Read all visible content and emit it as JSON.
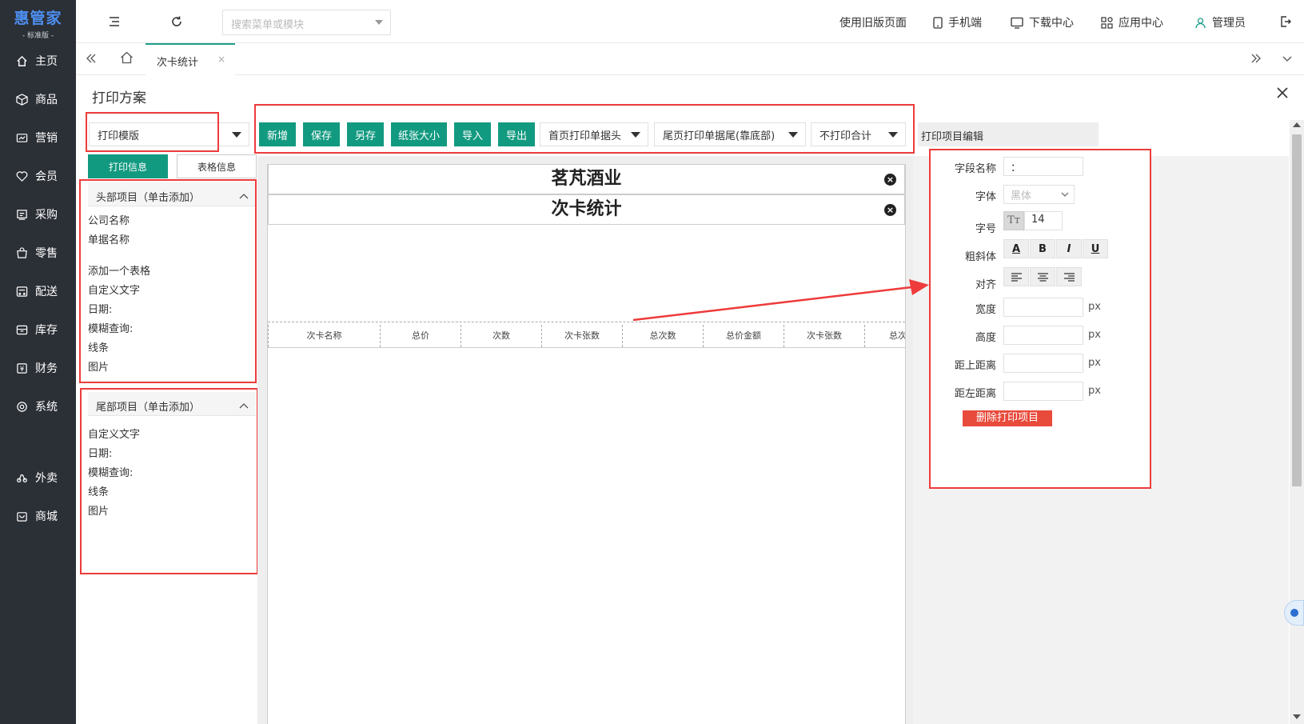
{
  "brand": {
    "name": "惠管家",
    "edition": "- 标准版 -"
  },
  "sidebar": {
    "items": [
      {
        "label": "主页",
        "icon": "home-icon"
      },
      {
        "label": "商品",
        "icon": "box-icon"
      },
      {
        "label": "营销",
        "icon": "marketing-icon"
      },
      {
        "label": "会员",
        "icon": "member-icon"
      },
      {
        "label": "采购",
        "icon": "purchase-icon"
      },
      {
        "label": "零售",
        "icon": "retail-icon"
      },
      {
        "label": "配送",
        "icon": "delivery-icon"
      },
      {
        "label": "库存",
        "icon": "inventory-icon"
      },
      {
        "label": "财务",
        "icon": "finance-icon"
      },
      {
        "label": "系统",
        "icon": "system-icon"
      },
      {
        "label": "外卖",
        "icon": "takeout-icon"
      },
      {
        "label": "商城",
        "icon": "mall-icon"
      }
    ]
  },
  "topbar": {
    "search_placeholder": "搜索菜单或模块",
    "old_version": "使用旧版页面",
    "mobile": "手机端",
    "download": "下载中心",
    "apps": "应用中心",
    "user": "管理员"
  },
  "tabs": {
    "active": "次卡统计"
  },
  "page": {
    "title": "打印方案"
  },
  "template_select": {
    "value": "打印模版"
  },
  "toolbar": {
    "new": "新增",
    "save": "保存",
    "save_as": "另存",
    "paper_size": "纸张大小",
    "import": "导入",
    "export": "导出",
    "first_page": "首页打印单据头",
    "last_page": "尾页打印单据尾(靠底部)",
    "total": "不打印合计"
  },
  "left_tabs": {
    "print_info": "打印信息",
    "table_info": "表格信息"
  },
  "header_panel": {
    "title": "头部项目（单击添加）",
    "items": [
      "公司名称",
      "单据名称",
      "",
      "添加一个表格",
      "自定义文字",
      "日期:",
      "模糊查询:",
      "线条",
      "图片"
    ]
  },
  "footer_panel": {
    "title": "尾部项目（单击添加）",
    "items": [
      "自定义文字",
      "日期:",
      "模糊查询:",
      "线条",
      "图片"
    ]
  },
  "canvas": {
    "company": "茗芃酒业",
    "doc_name": "次卡统计",
    "columns": [
      "次卡名称",
      "总价",
      "次数",
      "次卡张数",
      "总次数",
      "总价金额",
      "次卡张数",
      "总次"
    ]
  },
  "editor": {
    "title": "打印项目编辑",
    "field_name_label": "字段名称",
    "field_name_value": "：",
    "font_label": "字体",
    "font_value": "黑体",
    "size_label": "字号",
    "size_value": "14",
    "style_label": "粗斜体",
    "align_label": "对齐",
    "width_label": "宽度",
    "height_label": "高度",
    "top_label": "距上距离",
    "left_label": "距左距离",
    "unit": "px",
    "delete_button": "删除打印项目",
    "bold": "B",
    "italic": "I",
    "underline": "U",
    "font_color": "A"
  },
  "colors": {
    "accent": "#129a80",
    "annotation": "#ee3b3b",
    "sidebar": "#2b2f36",
    "delete": "#e84a3b"
  }
}
